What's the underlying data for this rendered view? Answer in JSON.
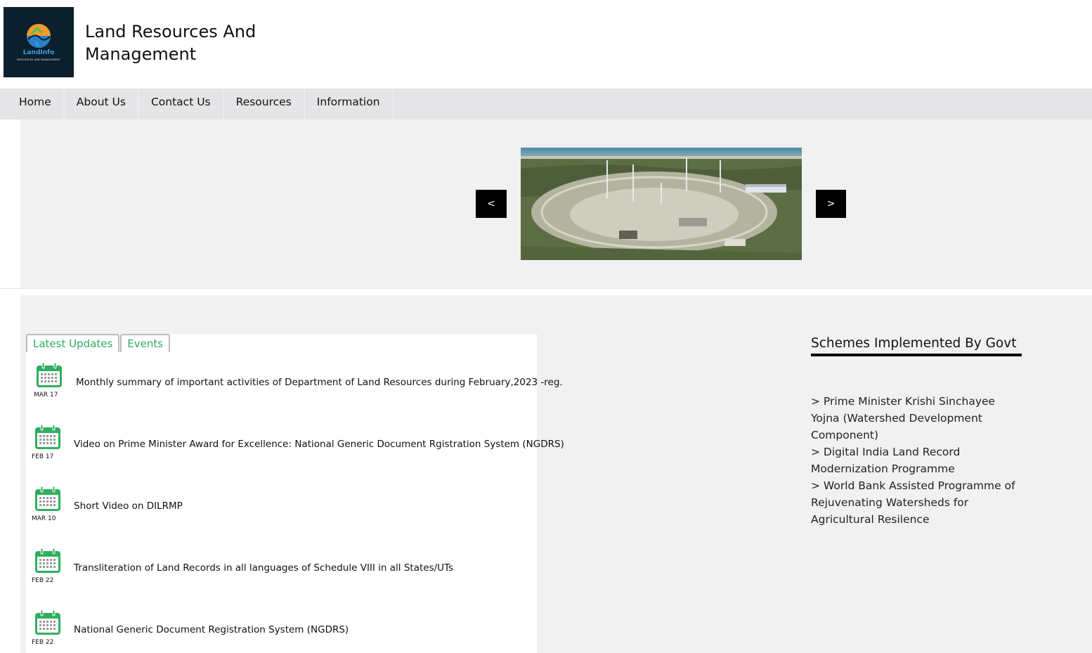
{
  "header": {
    "logo_text": "LandInfo",
    "logo_subtext": "RESOURCES AND MANAGEMENT",
    "title_line1": "Land Resources And",
    "title_line2": "Management"
  },
  "nav": {
    "items": [
      "Home",
      "About Us",
      "Contact Us",
      "Resources",
      "Information"
    ]
  },
  "slider": {
    "prev_label": "<",
    "next_label": ">",
    "image_icon": "launch-site-aerial-photo"
  },
  "tabs": [
    "Latest Updates",
    "Events"
  ],
  "updates": [
    {
      "date": "MAR 17",
      "text": "Monthly summary of important activities of Department of Land Resources during February,2023 -reg."
    },
    {
      "date": "FEB 17",
      "text": "Video on Prime Minister Award for Excellence: National Generic Document Rgistration System (NGDRS)"
    },
    {
      "date": "MAR 10",
      "text": "Short Video on DILRMP"
    },
    {
      "date": "FEB 22",
      "text": "Transliteration of Land Records in all languages of Schedule VIII in all States/UTs"
    },
    {
      "date": "FEB 22",
      "text": "National Generic Document Registration System (NGDRS)"
    }
  ],
  "schemes": {
    "title": "Schemes Implemented By Govt",
    "items": [
      "> Prime Minister Krishi Sinchayee Yojna (Watershed Development Component)",
      "> Digital India Land Record Modernization Programme",
      "> World Bank Assisted Programme of Rejuvenating Watersheds for Agricultural Resilence"
    ]
  },
  "colors": {
    "accent_green": "#2fae5f",
    "nav_bg": "#e5e5e7",
    "logo_bg": "#0b1f2d"
  }
}
